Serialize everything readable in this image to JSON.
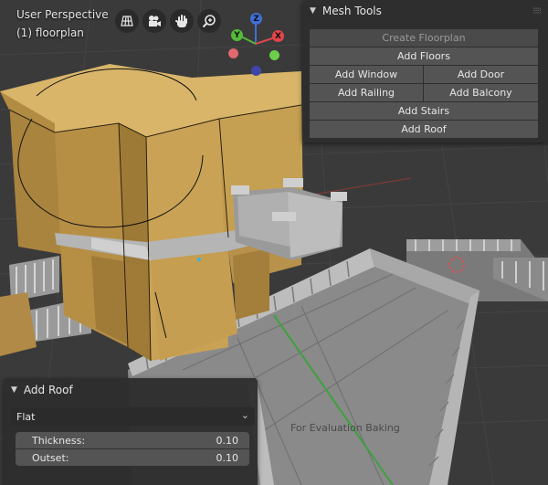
{
  "viewport": {
    "title": "User Perspective",
    "object_name": "(1) floorplan",
    "watermark": "For Evaluation Baking"
  },
  "nav_icons": [
    "grid-icon",
    "camera-icon",
    "hand-icon",
    "zoom-icon"
  ],
  "gizmo": {
    "z_label": "Z",
    "y_label": "Y",
    "x_label": "X",
    "colors": {
      "x": "#e0464a",
      "y": "#54bb3a",
      "z": "#3f6fd6",
      "neg_x": "#e06a6e",
      "neg_y": "#6ccf4b",
      "neg_z": "#3e47a8"
    }
  },
  "mesh_tools": {
    "title": "Mesh Tools",
    "buttons": {
      "create_floorplan": "Create Floorplan",
      "add_floors": "Add Floors",
      "add_window": "Add Window",
      "add_door": "Add Door",
      "add_railing": "Add Railing",
      "add_balcony": "Add Balcony",
      "add_stairs": "Add Stairs",
      "add_roof": "Add Roof"
    }
  },
  "add_roof_panel": {
    "title": "Add Roof",
    "type_selected": "Flat",
    "thickness_label": "Thickness:",
    "thickness_value": "0.10",
    "outset_label": "Outset:",
    "outset_value": "0.10"
  },
  "colors": {
    "grid_bg": "#3a3a3a",
    "wall_tan": "#c29a4e",
    "floor_gray": "#7d7d7d",
    "railing": "#b8b8b8",
    "button": "#545454",
    "panel": "#2e2e2e"
  }
}
